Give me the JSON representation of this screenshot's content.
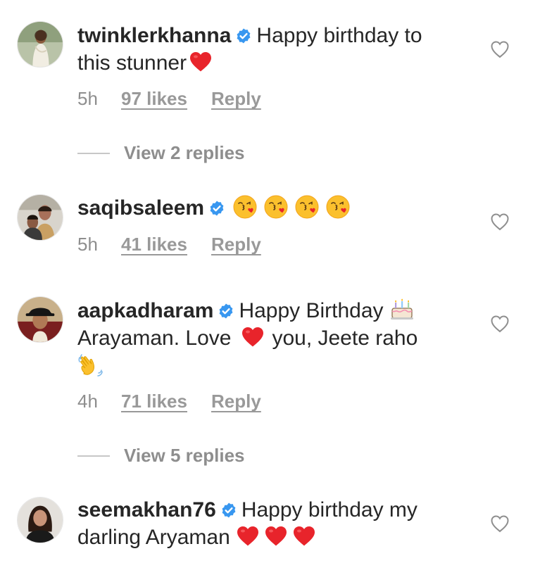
{
  "comments": [
    {
      "username": "twinklerkhanna",
      "text_line1": "Happy birthday to",
      "text_line2": "this stunner",
      "time": "5h",
      "likes": "97 likes",
      "reply": "Reply",
      "view_replies": "View 2 replies",
      "avatar_icon": "avatar-woman-white-saree"
    },
    {
      "username": "saqibsaleem",
      "time": "5h",
      "likes": "41 likes",
      "reply": "Reply",
      "avatar_icon": "avatar-man-and-woman"
    },
    {
      "username": "aapkadharam",
      "text_line1": "Happy Birthday",
      "text_line2a": "Arayaman. Love",
      "text_line2b": "you, Jeete raho",
      "time": "4h",
      "likes": "71 likes",
      "reply": "Reply",
      "view_replies": "View 5 replies",
      "avatar_icon": "avatar-man-black-hat"
    },
    {
      "username": "seemakhan76",
      "text_line1": "Happy birthday my",
      "text_line2": "darling Aryaman",
      "avatar_icon": "avatar-woman-dark-hair"
    }
  ],
  "colors": {
    "text": "#262626",
    "meta": "#8e8e8e",
    "verified_blue": "#3897f0",
    "heart_red": "#e8242b"
  }
}
